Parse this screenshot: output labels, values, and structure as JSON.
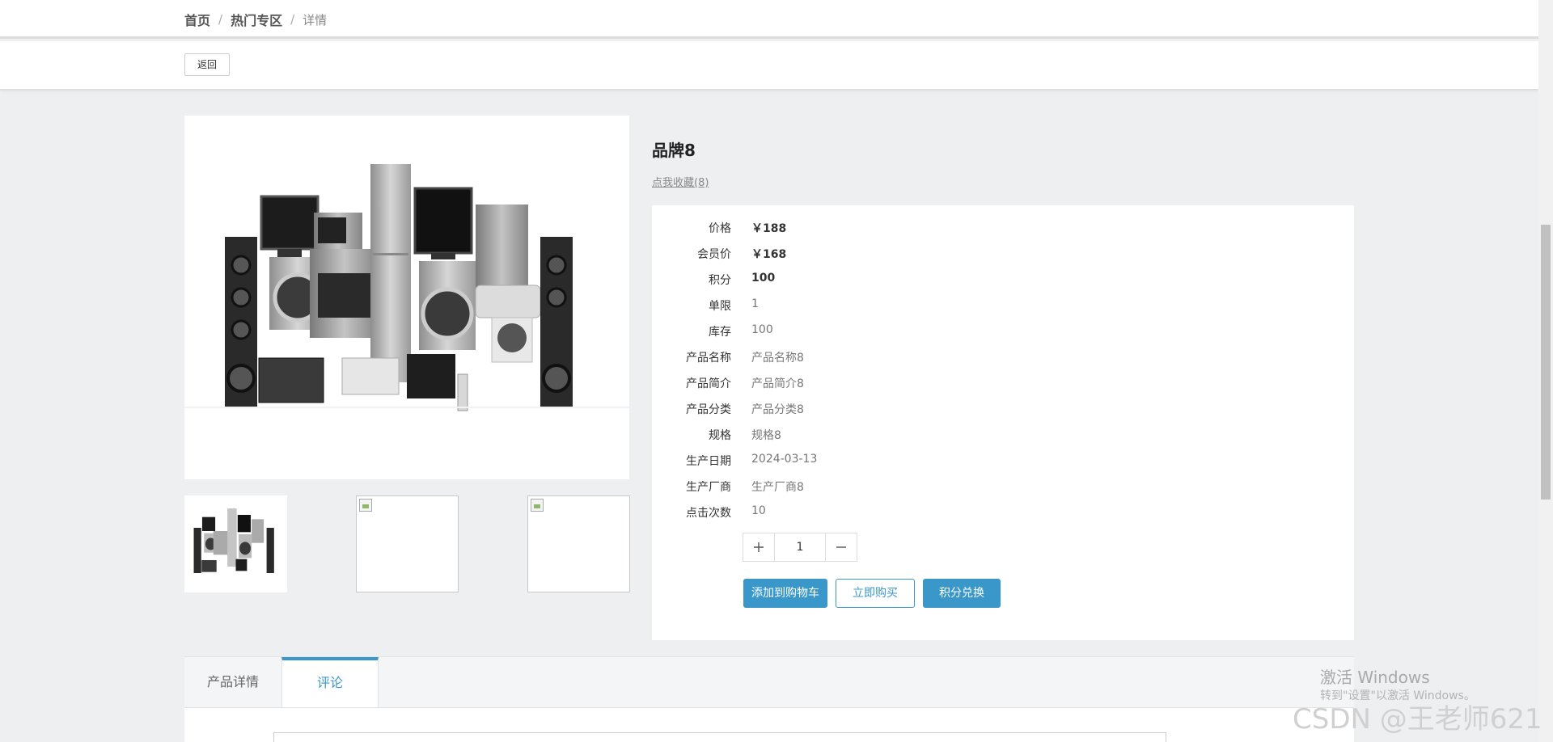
{
  "breadcrumb": {
    "home": "首页",
    "section": "热门专区",
    "current": "详情",
    "separator": "/"
  },
  "actions": {
    "back_label": "返回"
  },
  "product": {
    "title": "品牌8",
    "favorite_label": "点我收藏(8)",
    "fields": [
      {
        "label": "价格",
        "value": "￥188",
        "bold": true
      },
      {
        "label": "会员价",
        "value": "￥168",
        "bold": true
      },
      {
        "label": "积分",
        "value": "100",
        "bold": true
      },
      {
        "label": "单限",
        "value": "1",
        "bold": false
      },
      {
        "label": "库存",
        "value": "100",
        "bold": false
      },
      {
        "label": "产品名称",
        "value": "产品名称8",
        "bold": false
      },
      {
        "label": "产品简介",
        "value": "产品简介8",
        "bold": false
      },
      {
        "label": "产品分类",
        "value": "产品分类8",
        "bold": false
      },
      {
        "label": "规格",
        "value": "规格8",
        "bold": false
      },
      {
        "label": "生产日期",
        "value": "2024-03-13",
        "bold": false
      },
      {
        "label": "生产厂商",
        "value": "生产厂商8",
        "bold": false
      },
      {
        "label": "点击次数",
        "value": "10",
        "bold": false
      }
    ],
    "quantity": "1",
    "buttons": {
      "add_to_cart": "添加到购物车",
      "buy_now": "立即购买",
      "points_exchange": "积分兑换"
    }
  },
  "tabs": [
    {
      "label": "产品详情"
    },
    {
      "label": "评论"
    }
  ],
  "watermarks": {
    "windows_title": "激活 Windows",
    "windows_sub": "转到\"设置\"以激活 Windows。",
    "csdn": "CSDN @王老师621"
  },
  "colors": {
    "accent": "#3a97c9",
    "background": "#eeeff1"
  }
}
